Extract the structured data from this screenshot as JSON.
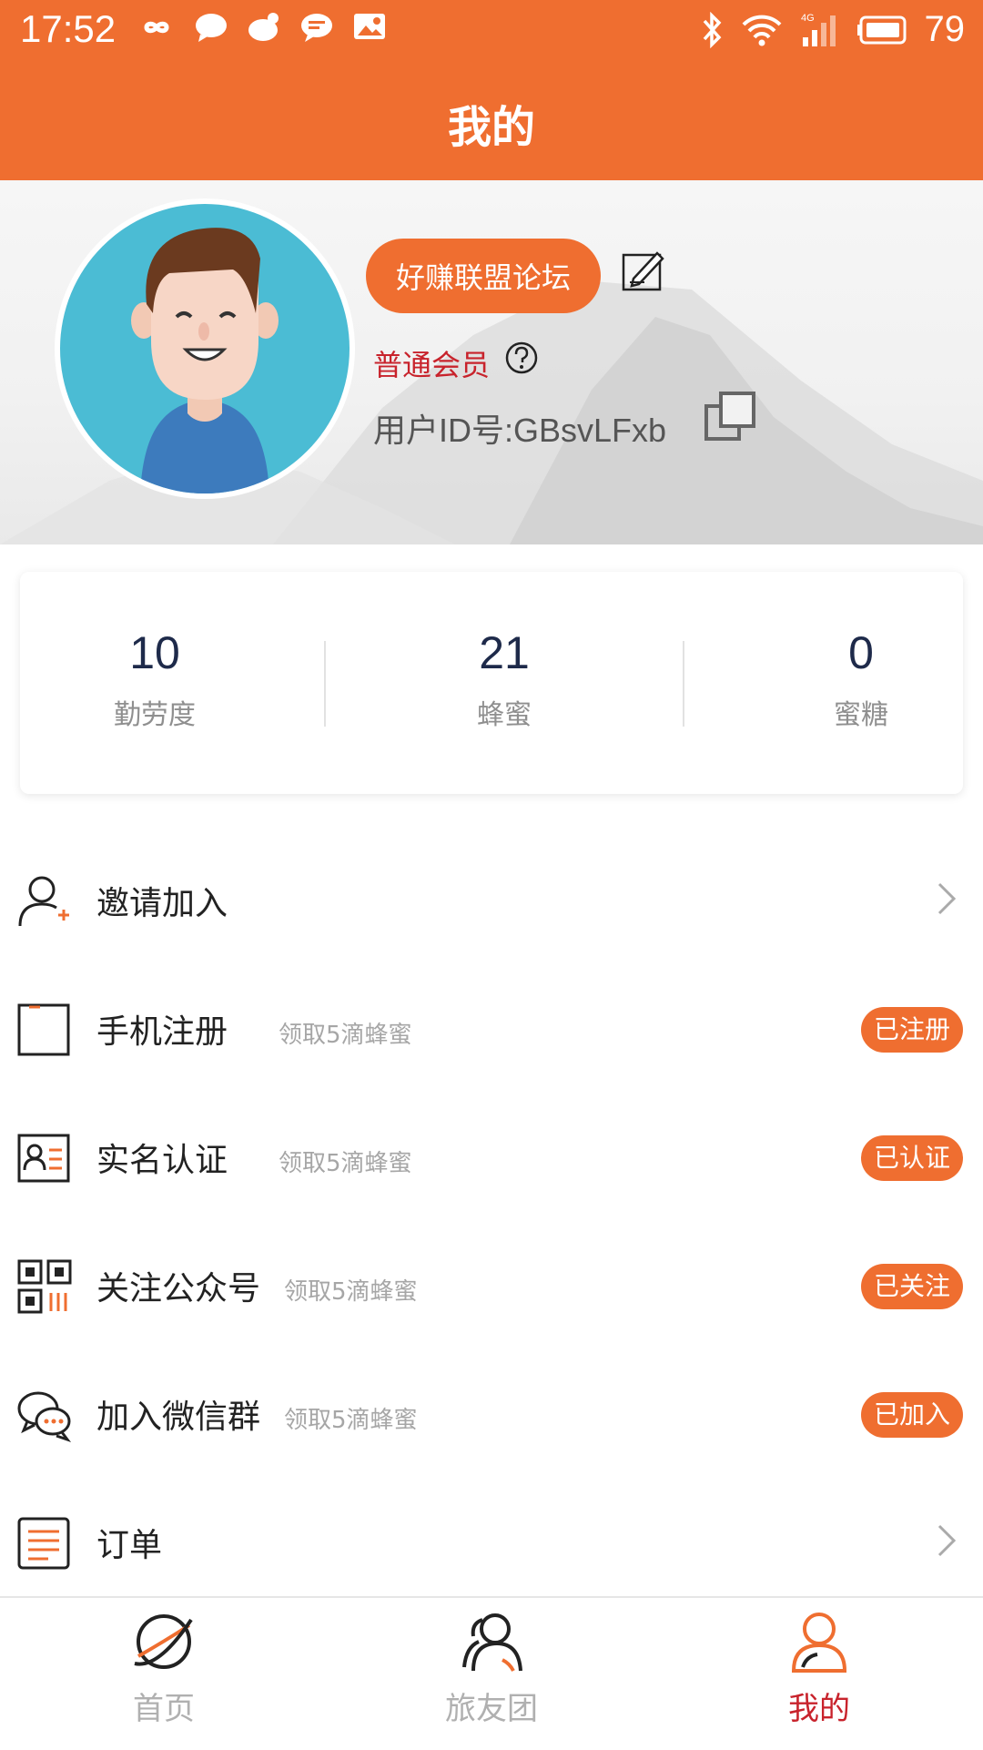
{
  "status_bar": {
    "time": "17:52",
    "battery": "79",
    "network": "4G"
  },
  "header": {
    "title": "我的"
  },
  "profile": {
    "forum_button": "好赚联盟论坛",
    "member_level": "普通会员",
    "user_id": "用户ID号:GBsvLFxb"
  },
  "stats": [
    {
      "value": "10",
      "label": "勤劳度"
    },
    {
      "value": "21",
      "label": "蜂蜜"
    },
    {
      "value": "0",
      "label": "蜜糖"
    }
  ],
  "menu": [
    {
      "label": "邀请加入",
      "icon": "invite-user-icon"
    },
    {
      "label": "手机注册",
      "sub": "领取5滴蜂蜜",
      "badge": "已注册",
      "icon": "phone-icon"
    },
    {
      "label": "实名认证",
      "sub": "领取5滴蜂蜜",
      "badge": "已认证",
      "icon": "id-card-icon"
    },
    {
      "label": "关注公众号",
      "sub": "领取5滴蜂蜜",
      "badge": "已关注",
      "icon": "qr-code-icon"
    },
    {
      "label": "加入微信群",
      "sub": "领取5滴蜂蜜",
      "badge": "已加入",
      "icon": "wechat-group-icon"
    },
    {
      "label": "订单",
      "icon": "order-list-icon"
    }
  ],
  "tabs": [
    {
      "label": "首页",
      "icon": "planet-icon",
      "active": false
    },
    {
      "label": "旅友团",
      "icon": "group-icon",
      "active": false
    },
    {
      "label": "我的",
      "icon": "person-icon",
      "active": true
    }
  ],
  "colors": {
    "accent": "#ef6e30",
    "member_red": "#c8232c",
    "active_tab": "#c8232c",
    "inactive_tab": "#b0b0b0",
    "stat_number": "#1e2a4a"
  }
}
